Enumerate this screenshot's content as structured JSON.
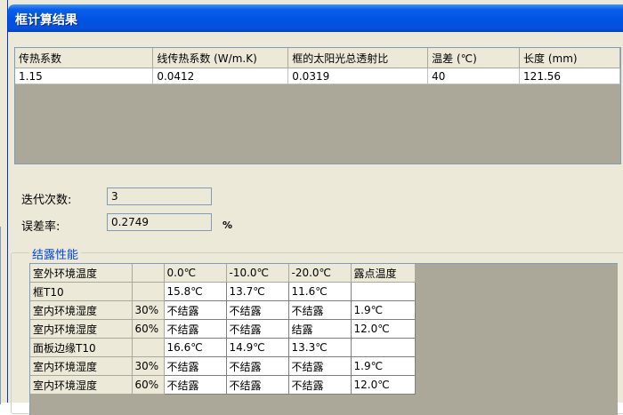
{
  "window": {
    "title": "框计算结果"
  },
  "results": {
    "headers": [
      "传热系数",
      "线传热系数 (W/m.K)",
      "框的太阳光总透射比",
      "温差 (℃)",
      "长度 (mm)"
    ],
    "row": [
      "1.15",
      "0.0412",
      "0.0319",
      "40",
      "121.56"
    ]
  },
  "iterations": {
    "label": "迭代次数:",
    "value": "3"
  },
  "error_rate": {
    "label": "误差率:",
    "value": "0.2749",
    "unit": "%"
  },
  "dew": {
    "group_label": "结露性能",
    "header": [
      "室外环境温度",
      "",
      "0.0℃",
      "-10.0℃",
      "-20.0℃",
      "露点温度"
    ],
    "rows": [
      [
        "框T10",
        "",
        "15.8℃",
        "13.7℃",
        "11.6℃",
        ""
      ],
      [
        "室内环境湿度",
        "30%",
        "不结露",
        "不结露",
        "不结露",
        "1.9℃"
      ],
      [
        "室内环境湿度",
        "60%",
        "不结露",
        "不结露",
        "结露",
        "12.0℃"
      ],
      [
        "面板边缘T10",
        "",
        "16.6℃",
        "14.9℃",
        "13.3℃",
        ""
      ],
      [
        "室内环境湿度",
        "30%",
        "不结露",
        "不结露",
        "不结露",
        "1.9℃"
      ],
      [
        "室内环境湿度",
        "60%",
        "不结露",
        "不结露",
        "不结露",
        "12.0℃"
      ]
    ]
  }
}
